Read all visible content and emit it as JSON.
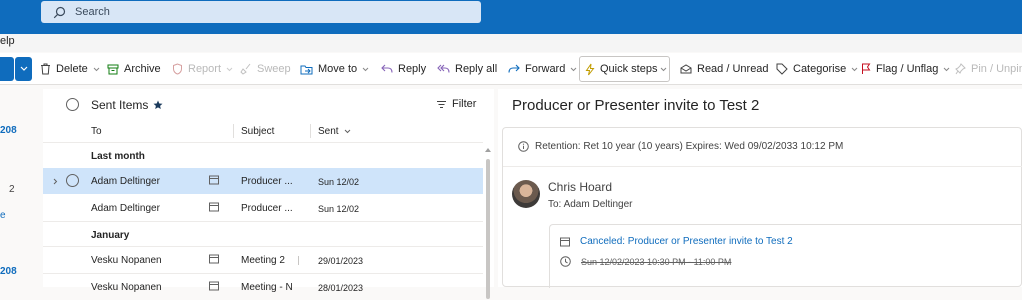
{
  "search": {
    "placeholder": "Search"
  },
  "menubar": {
    "partial_label": "elp"
  },
  "ribbon": {
    "delete": "Delete",
    "archive": "Archive",
    "report": "Report",
    "sweep": "Sweep",
    "move_to": "Move to",
    "reply": "Reply",
    "reply_all": "Reply all",
    "forward": "Forward",
    "quick_steps": "Quick steps",
    "read_unread": "Read / Unread",
    "categorise": "Categorise",
    "flag_unflag": "Flag / Unflag",
    "pin_unpin": "Pin / Unpin"
  },
  "rail": {
    "count_a": "208",
    "count_b": "2",
    "partial": "e",
    "count_c": "208"
  },
  "list": {
    "folder_title": "Sent Items",
    "filter_label": "Filter",
    "columns": {
      "to": "To",
      "subject": "Subject",
      "sent": "Sent"
    },
    "groups": [
      {
        "label": "Last month",
        "rows": [
          {
            "to": "Adam Deltinger",
            "subject": "Producer ...",
            "sent": "Sun 12/02",
            "selected": true
          },
          {
            "to": "Adam Deltinger",
            "subject": "Producer ...",
            "sent": "Sun 12/02",
            "selected": false
          }
        ]
      },
      {
        "label": "January",
        "rows": [
          {
            "to": "Vesku Nopanen",
            "subject": "Meeting 2",
            "sent": "29/01/2023",
            "selected": false
          },
          {
            "to": "Vesku Nopanen",
            "subject": "Meeting - N",
            "sent": "28/01/2023",
            "selected": false
          }
        ]
      }
    ]
  },
  "reading": {
    "subject": "Producer or Presenter invite to Test 2",
    "retention": "Retention: Ret 10 year (10 years) Expires: Wed 09/02/2033 10:12 PM",
    "sender": "Chris Hoard",
    "to_line": "To:  Adam Deltinger",
    "meeting_title": "Canceled: Producer or Presenter invite to Test 2",
    "meeting_time": "Sun 12/02/2023 10:30 PM - 11:00 PM"
  },
  "colors": {
    "brand": "#0f6cbd",
    "selection": "#cfe4fa",
    "flag": "#c50f1f",
    "quick_steps": "#c19c00"
  }
}
